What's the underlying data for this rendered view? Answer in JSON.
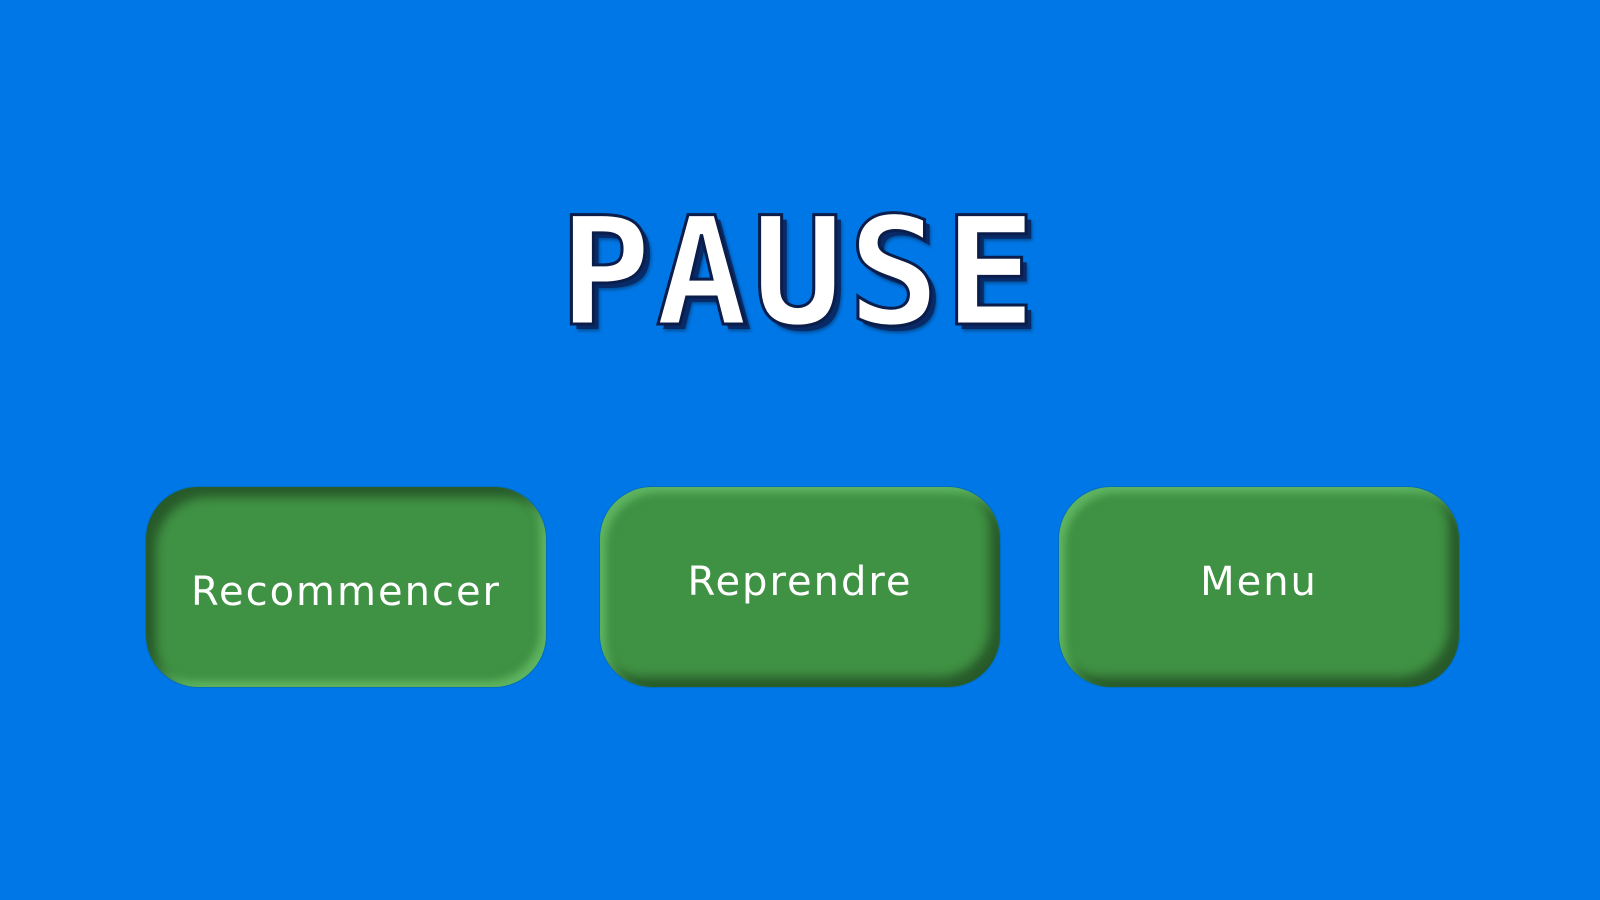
{
  "screen": {
    "title": "PAUSE",
    "background_color": "#0077e6"
  },
  "buttons": {
    "restart_label": "Recommencer",
    "resume_label": "Reprendre",
    "menu_label": "Menu",
    "button_color": "#3f9143"
  }
}
